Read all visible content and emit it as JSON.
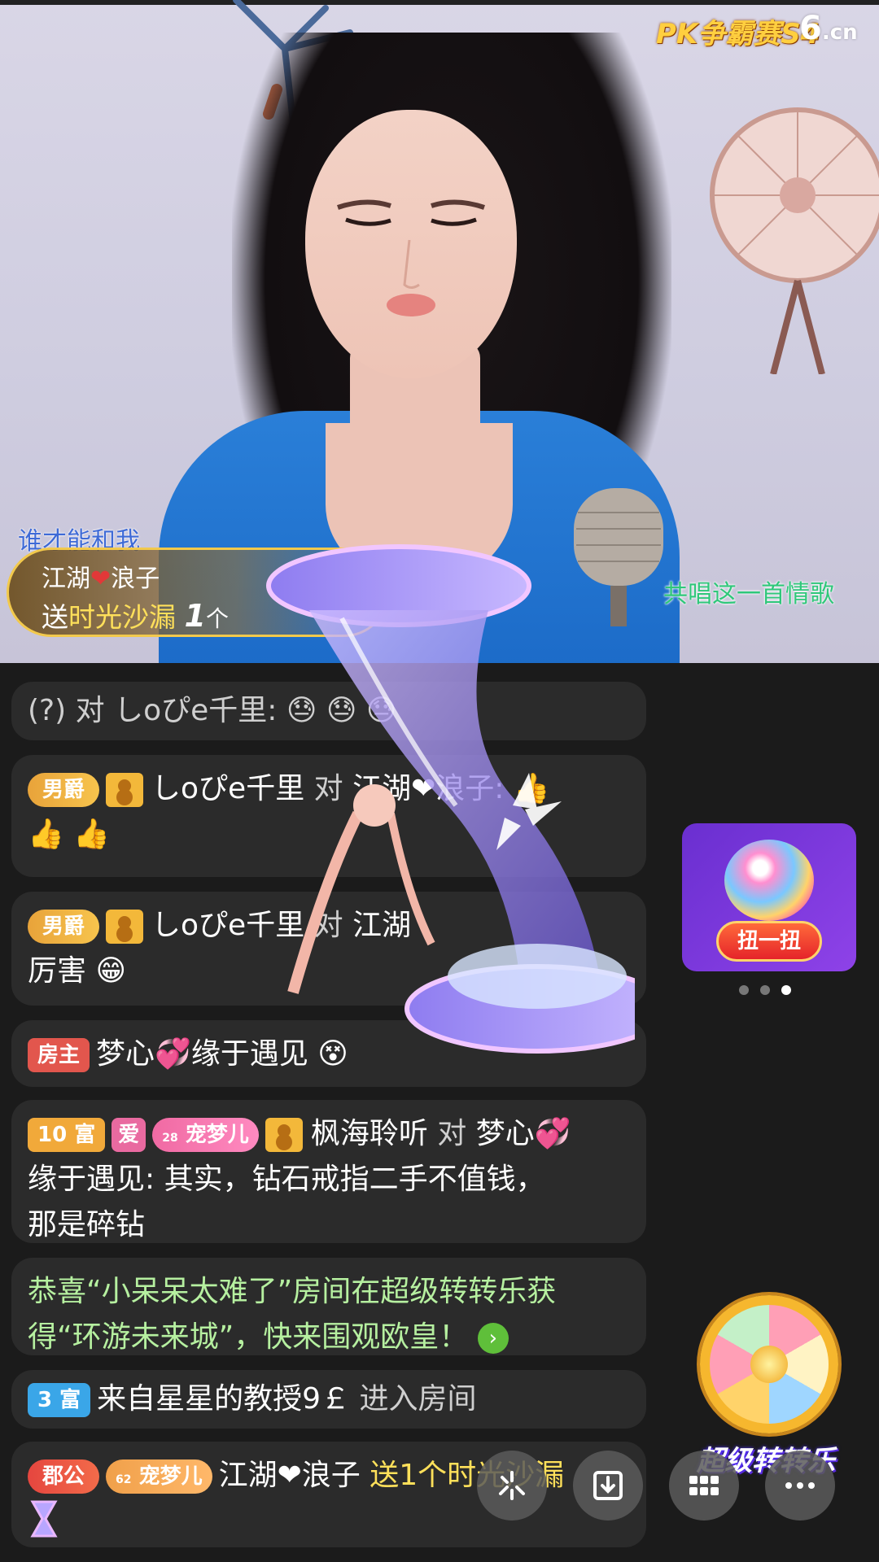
{
  "stream": {
    "brand_text": "PK争霸赛S4",
    "site_main": "6",
    "site_tld": ".cn",
    "caption_left": "谁才能和我",
    "caption_right": "共唱这一首情歌"
  },
  "gift_banner": {
    "sender_a": "江湖",
    "sender_heart": "❤",
    "sender_b": "浪子",
    "send_prefix": "送",
    "gift_name": "时光沙漏",
    "count": "1",
    "unit": "个"
  },
  "chat": {
    "m0": {
      "prefix": "(?) 对 ",
      "name": "しoぴe千里",
      "colon": ":",
      "emojis": "😓 😓 😓"
    },
    "m1": {
      "badge": "男爵",
      "name": "しoぴe千里",
      "mid": " 对 ",
      "target": "江湖❤浪子",
      "colon": ":",
      "emojis_line1": "👍",
      "emojis_line2": "👍 👍"
    },
    "m2": {
      "badge": "男爵",
      "name": "しoぴe千里",
      "mid": " 对 ",
      "target": "江湖",
      "text": "厉害",
      "emoji": "😁"
    },
    "m3": {
      "badge": "房主",
      "text": "梦心💞缘于遇见",
      "emoji": "😵"
    },
    "m4": {
      "badge_fu": "10 富",
      "badge_ai": "爱",
      "badge_pet_level": "28",
      "badge_pet": "宠梦儿",
      "name": "枫海聆听",
      "mid": " 对 ",
      "target": "梦心💞",
      "line2": "缘于遇见: 其实，钻石戒指二手不值钱，",
      "line3": "那是碎钻"
    },
    "m5": {
      "line1": "恭喜“小呆呆太难了”房间在超级转转乐获",
      "line2": "得“环游未来城”，快来围观欧皇！",
      "arrow": "›"
    },
    "m6": {
      "badge": "3 富",
      "name": "来自星星的教授9￡",
      "text": " 进入房间"
    },
    "m7": {
      "badge": "郡公",
      "badge_pet_level": "62",
      "badge_pet": "宠梦儿",
      "name": "江湖❤浪子",
      "text": " 送1个时光沙漏"
    }
  },
  "widgets": {
    "twist_label": "扭一扭",
    "wheel_label": "超级转转乐"
  },
  "icons": {
    "share": "share-icon",
    "download": "download-icon",
    "grid": "grid-icon",
    "more": "more-icon"
  },
  "colors": {
    "gift_name": "#ffe05a",
    "chat_bubble": "#2b2b2b",
    "caption_right": "#2fc77a"
  }
}
